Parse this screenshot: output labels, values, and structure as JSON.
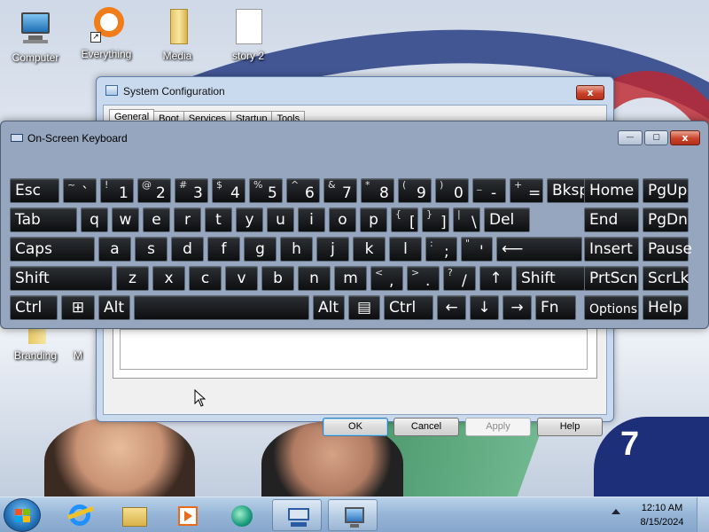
{
  "desktop": {
    "icons": [
      {
        "label": "Computer",
        "icon": "computer-icon"
      },
      {
        "label": "Everything",
        "icon": "everything-icon"
      },
      {
        "label": "Media",
        "icon": "folder-icon"
      },
      {
        "label": "story 2",
        "icon": "document-icon"
      },
      {
        "label": "Branding",
        "icon": "branding-icon"
      },
      {
        "label": "M",
        "icon": "partial-icon"
      }
    ]
  },
  "sysconfig": {
    "title": "System Configuration",
    "close_label": "x",
    "tabs": [
      "General",
      "Boot",
      "Services",
      "Startup",
      "Tools"
    ],
    "buttons": {
      "ok": "OK",
      "cancel": "Cancel",
      "apply": "Apply",
      "help": "Help"
    }
  },
  "osk": {
    "title": "On-Screen Keyboard",
    "min_label": "—",
    "max_label": "▢",
    "close_label": "x",
    "rows": [
      [
        {
          "main": "Esc"
        },
        {
          "shift": "~",
          "low": "`"
        },
        {
          "shift": "!",
          "low": "1"
        },
        {
          "shift": "@",
          "low": "2"
        },
        {
          "shift": "#",
          "low": "3"
        },
        {
          "shift": "$",
          "low": "4"
        },
        {
          "shift": "%",
          "low": "5"
        },
        {
          "shift": "^",
          "low": "6"
        },
        {
          "shift": "&",
          "low": "7"
        },
        {
          "shift": "*",
          "low": "8"
        },
        {
          "shift": "(",
          "low": "9"
        },
        {
          "shift": ")",
          "low": "0"
        },
        {
          "shift": "_",
          "low": "-"
        },
        {
          "shift": "+",
          "low": "="
        },
        {
          "main": "Bksp"
        },
        {
          "main": "Home"
        },
        {
          "main": "PgUp"
        }
      ],
      [
        {
          "main": "Tab"
        },
        {
          "main": "q"
        },
        {
          "main": "w"
        },
        {
          "main": "e"
        },
        {
          "main": "r"
        },
        {
          "main": "t"
        },
        {
          "main": "y"
        },
        {
          "main": "u"
        },
        {
          "main": "i"
        },
        {
          "main": "o"
        },
        {
          "main": "p"
        },
        {
          "shift": "{",
          "low": "["
        },
        {
          "shift": "}",
          "low": "]"
        },
        {
          "shift": "|",
          "low": "\\"
        },
        {
          "main": "Del"
        },
        {
          "main": "End"
        },
        {
          "main": "PgDn"
        }
      ],
      [
        {
          "main": "Caps"
        },
        {
          "main": "a"
        },
        {
          "main": "s"
        },
        {
          "main": "d"
        },
        {
          "main": "f"
        },
        {
          "main": "g"
        },
        {
          "main": "h"
        },
        {
          "main": "j"
        },
        {
          "main": "k"
        },
        {
          "main": "l"
        },
        {
          "shift": ":",
          "low": ";"
        },
        {
          "shift": "\"",
          "low": "'"
        },
        {
          "main": "⟵"
        },
        {
          "main": "Insert"
        },
        {
          "main": "Pause"
        }
      ],
      [
        {
          "main": "Shift"
        },
        {
          "main": "z"
        },
        {
          "main": "x"
        },
        {
          "main": "c"
        },
        {
          "main": "v"
        },
        {
          "main": "b"
        },
        {
          "main": "n"
        },
        {
          "main": "m"
        },
        {
          "shift": "<",
          "low": ","
        },
        {
          "shift": ">",
          "low": "."
        },
        {
          "shift": "?",
          "low": "/"
        },
        {
          "main": "↑"
        },
        {
          "main": "Shift"
        },
        {
          "main": "PrtScn"
        },
        {
          "main": "ScrLk"
        }
      ],
      [
        {
          "main": "Ctrl"
        },
        {
          "main": "⊞"
        },
        {
          "main": "Alt"
        },
        {
          "main": ""
        },
        {
          "main": "Alt"
        },
        {
          "main": "▤"
        },
        {
          "main": "Ctrl"
        },
        {
          "main": "←"
        },
        {
          "main": "↓"
        },
        {
          "main": "→"
        },
        {
          "main": "Fn"
        },
        {
          "main": "Options"
        },
        {
          "main": "Help"
        }
      ]
    ]
  },
  "taskbar": {
    "start_icon": "windows-start-icon",
    "items": [
      {
        "icon": "internet-explorer-icon",
        "active": false
      },
      {
        "icon": "file-explorer-icon",
        "active": false
      },
      {
        "icon": "media-player-icon",
        "active": false
      },
      {
        "icon": "green-app-icon",
        "active": false
      },
      {
        "icon": "on-screen-keyboard-icon",
        "active": true
      },
      {
        "icon": "system-configuration-icon",
        "active": true
      }
    ],
    "time": "12:10 AM",
    "date": "8/15/2024"
  }
}
